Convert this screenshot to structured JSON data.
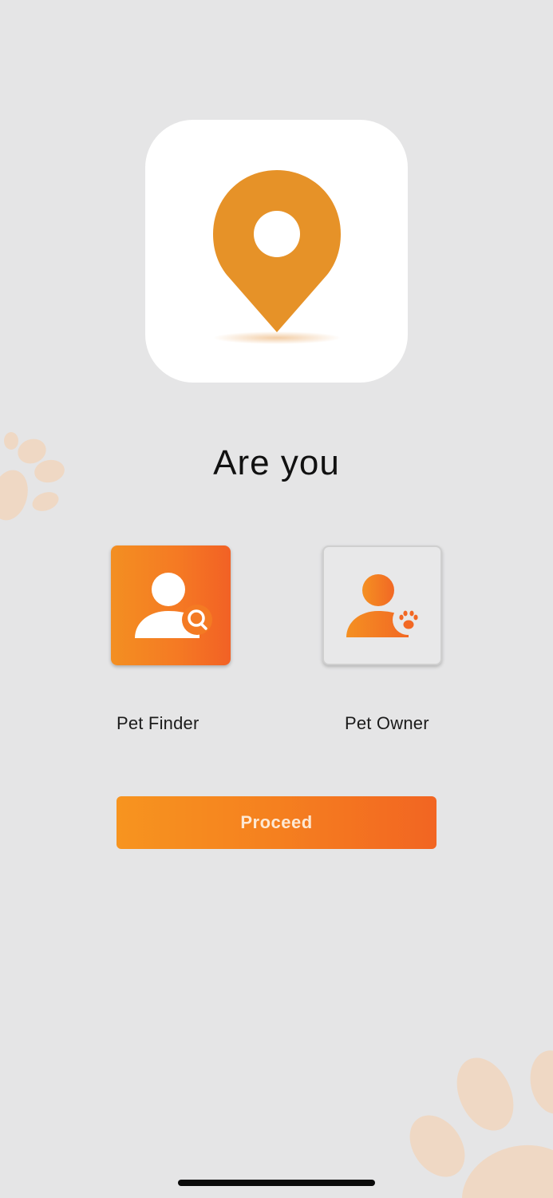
{
  "title": "Are you",
  "roles": [
    {
      "label": "Pet Finder",
      "icon": "user-search-icon",
      "selected": true
    },
    {
      "label": "Pet Owner",
      "icon": "user-paw-icon",
      "selected": false
    }
  ],
  "proceed_label": "Proceed",
  "colors": {
    "background": "#e5e5e6",
    "pin": "#e69228",
    "accent_start": "#f7941f",
    "accent_end": "#f26522",
    "paw_watermark": "#efd8c4"
  },
  "icons": {
    "logo": "location-pin-icon",
    "background": "paw-print-icon"
  }
}
